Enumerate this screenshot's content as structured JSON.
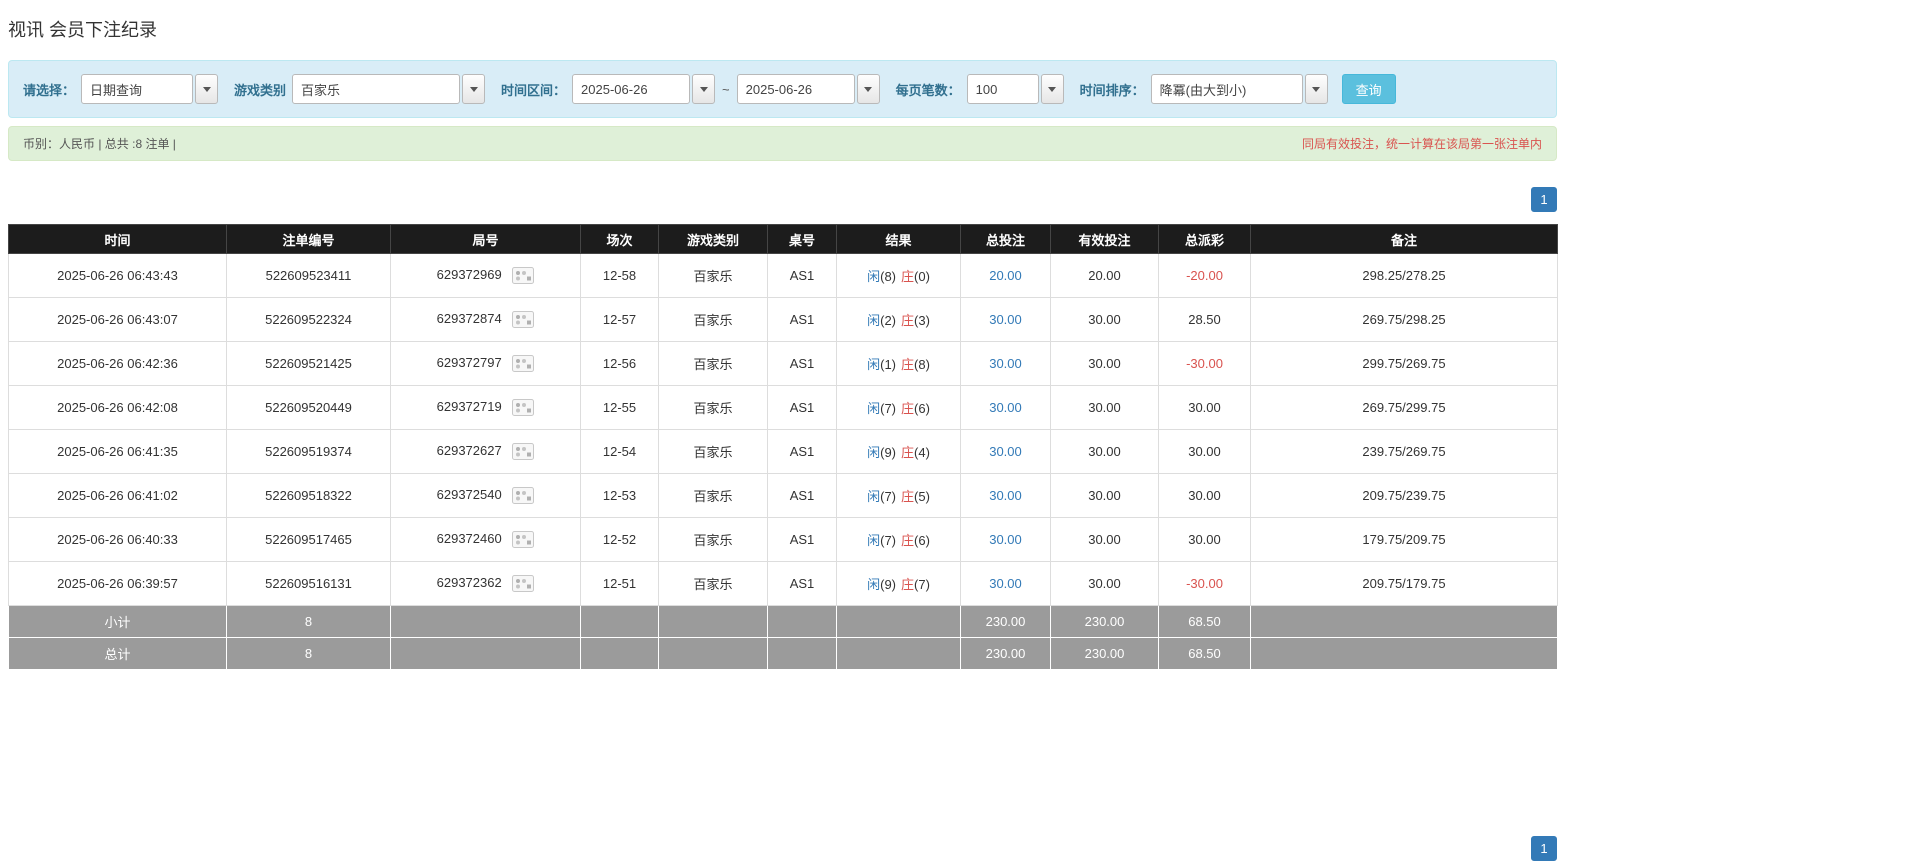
{
  "page_title": "视讯 会员下注纪录",
  "filters": {
    "select_label": "请选择：",
    "select_value": "日期查询",
    "game_label": "游戏类别",
    "game_value": "百家乐",
    "range_label": "时间区间：",
    "date_from": "2025-06-26",
    "range_separator": "~",
    "date_to": "2025-06-26",
    "per_page_label": "每页笔数：",
    "per_page_value": "100",
    "sort_label": "时间排序：",
    "sort_value": "降冪(由大到小)",
    "search_button": "查询"
  },
  "summary_bar": {
    "left_text": "币别：人民币 | 总共 :8 注单 |",
    "right_text": "同局有效投注，统一计算在该局第一张注单内"
  },
  "pagination": {
    "page": "1"
  },
  "icons": {
    "combo_caret": "caret-down",
    "round_icon": "roadmap-icon"
  },
  "colors": {
    "player_blue": "#337ab7",
    "banker_red": "#d9534f",
    "negative_red": "#d9534f",
    "link_blue": "#337ab7",
    "header_black": "#1c1c1c",
    "summary_gray": "#9b9b9b"
  },
  "table": {
    "headers": [
      "时间",
      "注单编号",
      "局号",
      "场次",
      "游戏类别",
      "桌号",
      "结果",
      "总投注",
      "有效投注",
      "总派彩",
      "备注"
    ],
    "rows": [
      {
        "time": "2025-06-26 06:43:43",
        "bet_id": "522609523411",
        "round": "629372969",
        "session": "12-58",
        "game": "百家乐",
        "table_no": "AS1",
        "player_label": "闲",
        "player_score": "(8)",
        "banker_label": "庄",
        "banker_score": "(0)",
        "total_bet": "20.00",
        "valid_bet": "20.00",
        "payout": "-20.00",
        "remark": "298.25/278.25"
      },
      {
        "time": "2025-06-26 06:43:07",
        "bet_id": "522609522324",
        "round": "629372874",
        "session": "12-57",
        "game": "百家乐",
        "table_no": "AS1",
        "player_label": "闲",
        "player_score": "(2)",
        "banker_label": "庄",
        "banker_score": "(3)",
        "total_bet": "30.00",
        "valid_bet": "30.00",
        "payout": "28.50",
        "remark": "269.75/298.25"
      },
      {
        "time": "2025-06-26 06:42:36",
        "bet_id": "522609521425",
        "round": "629372797",
        "session": "12-56",
        "game": "百家乐",
        "table_no": "AS1",
        "player_label": "闲",
        "player_score": "(1)",
        "banker_label": "庄",
        "banker_score": "(8)",
        "total_bet": "30.00",
        "valid_bet": "30.00",
        "payout": "-30.00",
        "remark": "299.75/269.75"
      },
      {
        "time": "2025-06-26 06:42:08",
        "bet_id": "522609520449",
        "round": "629372719",
        "session": "12-55",
        "game": "百家乐",
        "table_no": "AS1",
        "player_label": "闲",
        "player_score": "(7)",
        "banker_label": "庄",
        "banker_score": "(6)",
        "total_bet": "30.00",
        "valid_bet": "30.00",
        "payout": "30.00",
        "remark": "269.75/299.75"
      },
      {
        "time": "2025-06-26 06:41:35",
        "bet_id": "522609519374",
        "round": "629372627",
        "session": "12-54",
        "game": "百家乐",
        "table_no": "AS1",
        "player_label": "闲",
        "player_score": "(9)",
        "banker_label": "庄",
        "banker_score": "(4)",
        "total_bet": "30.00",
        "valid_bet": "30.00",
        "payout": "30.00",
        "remark": "239.75/269.75"
      },
      {
        "time": "2025-06-26 06:41:02",
        "bet_id": "522609518322",
        "round": "629372540",
        "session": "12-53",
        "game": "百家乐",
        "table_no": "AS1",
        "player_label": "闲",
        "player_score": "(7)",
        "banker_label": "庄",
        "banker_score": "(5)",
        "total_bet": "30.00",
        "valid_bet": "30.00",
        "payout": "30.00",
        "remark": "209.75/239.75"
      },
      {
        "time": "2025-06-26 06:40:33",
        "bet_id": "522609517465",
        "round": "629372460",
        "session": "12-52",
        "game": "百家乐",
        "table_no": "AS1",
        "player_label": "闲",
        "player_score": "(7)",
        "banker_label": "庄",
        "banker_score": "(6)",
        "total_bet": "30.00",
        "valid_bet": "30.00",
        "payout": "30.00",
        "remark": "179.75/209.75"
      },
      {
        "time": "2025-06-26 06:39:57",
        "bet_id": "522609516131",
        "round": "629372362",
        "session": "12-51",
        "game": "百家乐",
        "table_no": "AS1",
        "player_label": "闲",
        "player_score": "(9)",
        "banker_label": "庄",
        "banker_score": "(7)",
        "total_bet": "30.00",
        "valid_bet": "30.00",
        "payout": "-30.00",
        "remark": "209.75/179.75"
      }
    ],
    "subtotal": {
      "label": "小计",
      "count": "8",
      "total_bet": "230.00",
      "valid_bet": "230.00",
      "payout": "68.50"
    },
    "total": {
      "label": "总计",
      "count": "8",
      "total_bet": "230.00",
      "valid_bet": "230.00",
      "payout": "68.50"
    }
  }
}
